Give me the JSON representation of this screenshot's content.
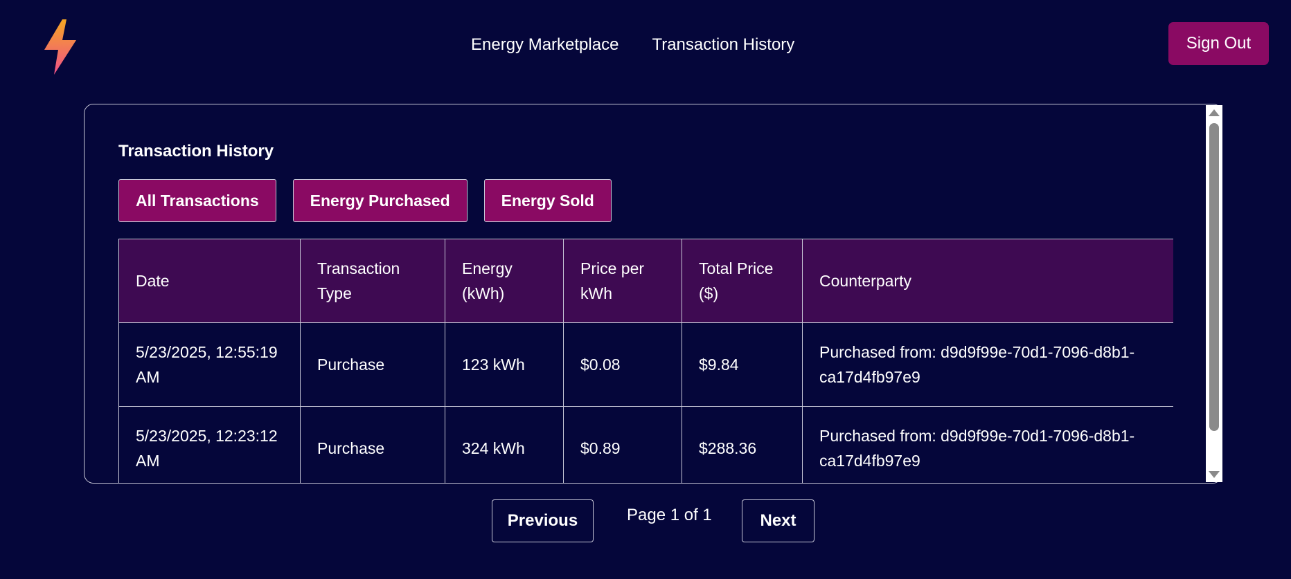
{
  "nav": {
    "links": [
      "Energy Marketplace",
      "Transaction History"
    ],
    "sign_out": "Sign Out"
  },
  "logo": {
    "icon": "lightning-bolt-icon"
  },
  "panel": {
    "title": "Transaction History",
    "filters": [
      "All Transactions",
      "Energy Purchased",
      "Energy Sold"
    ]
  },
  "table": {
    "headers": [
      "Date",
      "Transaction Type",
      "Energy (kWh)",
      "Price per kWh",
      "Total Price ($)",
      "Counterparty"
    ],
    "rows": [
      [
        "5/23/2025, 12:55:19 AM",
        "Purchase",
        "123 kWh",
        "$0.08",
        "$9.84",
        "Purchased from: d9d9f99e-70d1-7096-d8b1-ca17d4fb97e9"
      ],
      [
        "5/23/2025, 12:23:12 AM",
        "Purchase",
        "324 kWh",
        "$0.89",
        "$288.36",
        "Purchased from: d9d9f99e-70d1-7096-d8b1-ca17d4fb97e9"
      ]
    ]
  },
  "pagination": {
    "previous": "Previous",
    "info": "Page 1 of 1",
    "next": "Next"
  },
  "colors": {
    "background": "#05063a",
    "accent": "#8a0a63",
    "header_row": "#3e0a52"
  }
}
